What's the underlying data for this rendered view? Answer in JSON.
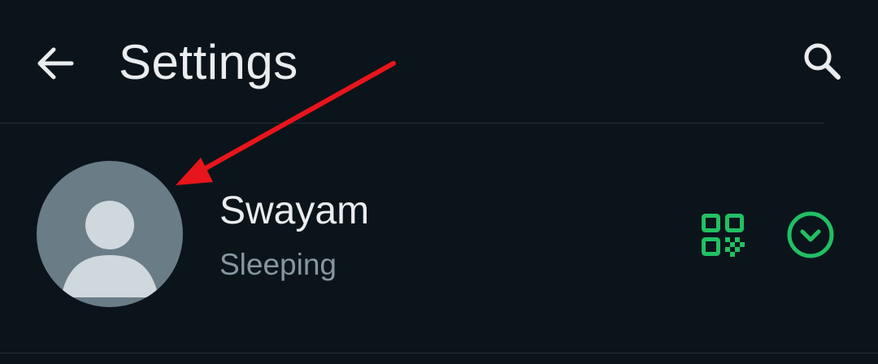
{
  "header": {
    "title": "Settings",
    "back_icon": "arrow-left-icon",
    "search_icon": "search-icon"
  },
  "profile": {
    "name": "Swayam",
    "about": "Sleeping",
    "avatar_icon": "default-person-avatar",
    "qr_icon": "qr-code-icon",
    "expand_icon": "chevron-down-circle-icon"
  },
  "colors": {
    "background": "#0b141b",
    "primary_text": "#e9edef",
    "secondary_text": "#8696a0",
    "accent": "#21c063",
    "avatar_bg": "#6a7c86",
    "annotation_arrow": "#e8151b"
  }
}
